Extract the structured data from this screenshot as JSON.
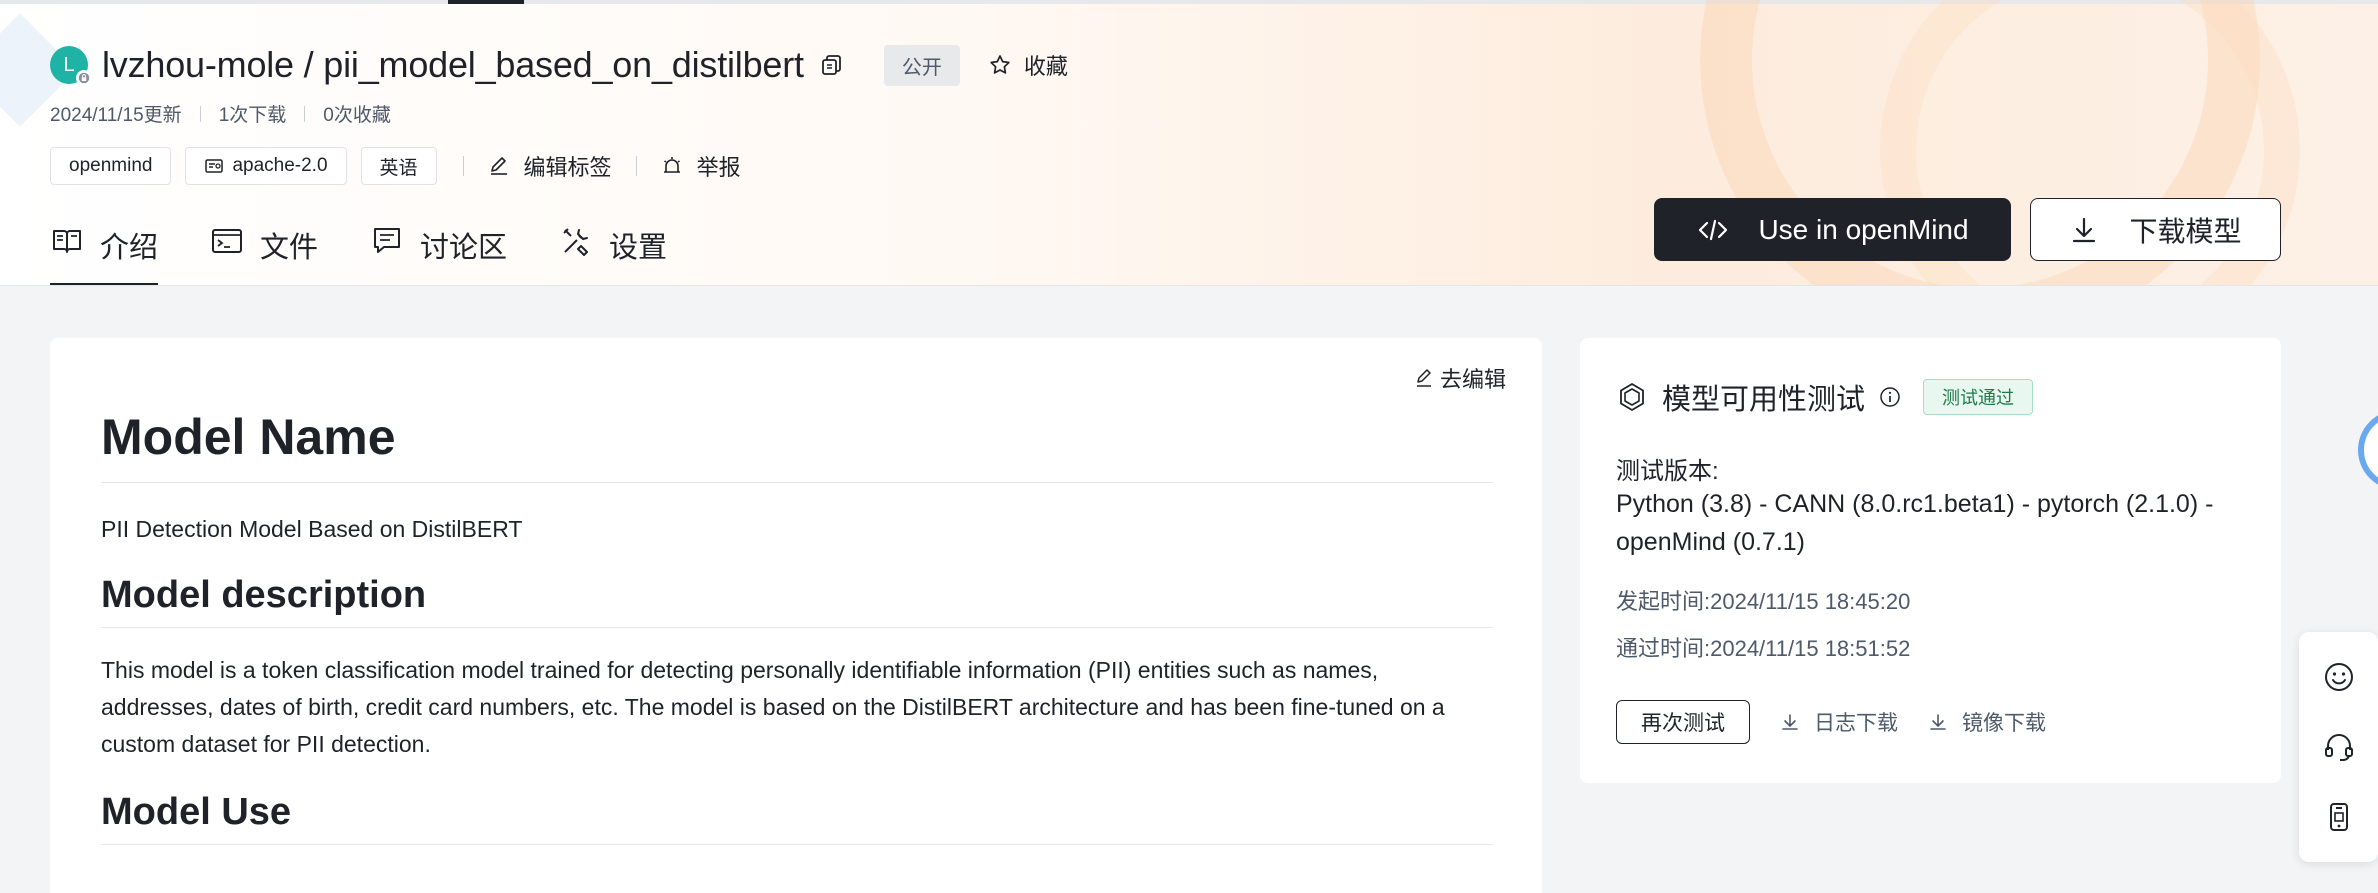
{
  "repo": {
    "avatar_letter": "L",
    "title": "lvzhou-mole / pii_model_based_on_distilbert",
    "visibility": "公开",
    "favorite_label": "收藏"
  },
  "meta": {
    "updated": "2024/11/15更新",
    "downloads": "1次下载",
    "favorites": "0次收藏"
  },
  "tags": {
    "items": [
      "openmind",
      "apache-2.0",
      "英语"
    ],
    "edit_tags_label": "编辑标签",
    "report_label": "举报"
  },
  "tabs": [
    {
      "label": "介绍",
      "icon": "book-icon",
      "active": true
    },
    {
      "label": "文件",
      "icon": "terminal-icon",
      "active": false
    },
    {
      "label": "讨论区",
      "icon": "chat-icon",
      "active": false
    },
    {
      "label": "设置",
      "icon": "tools-icon",
      "active": false
    }
  ],
  "header_buttons": {
    "use_label": "Use in openMind",
    "download_label": "下载模型"
  },
  "readme": {
    "edit_label": "去编辑",
    "h1": "Model Name",
    "p1": "PII Detection Model Based on DistilBERT",
    "h2_1": "Model description",
    "p2": "This model is a token classification model trained for detecting personally identifiable information (PII) entities such as names, addresses, dates of birth, credit card numbers, etc. The model is based on the DistilBERT architecture and has been fine-tuned on a custom dataset for PII detection.",
    "h2_2": "Model Use"
  },
  "test_panel": {
    "title": "模型可用性测试",
    "status": "测试通过",
    "version_label": "测试版本:",
    "version_text": "Python (3.8) - CANN (8.0.rc1.beta1) - pytorch (2.1.0) - openMind (0.7.1)",
    "start_time": "发起时间:2024/11/15 18:45:20",
    "pass_time": "通过时间:2024/11/15 18:51:52",
    "retest_label": "再次测试",
    "log_download_label": "日志下载",
    "image_download_label": "镜像下载"
  },
  "colors": {
    "primary_dark": "#1f2329",
    "pass_green": "#1f7a4a",
    "avatar_teal": "#1fb3a6"
  }
}
